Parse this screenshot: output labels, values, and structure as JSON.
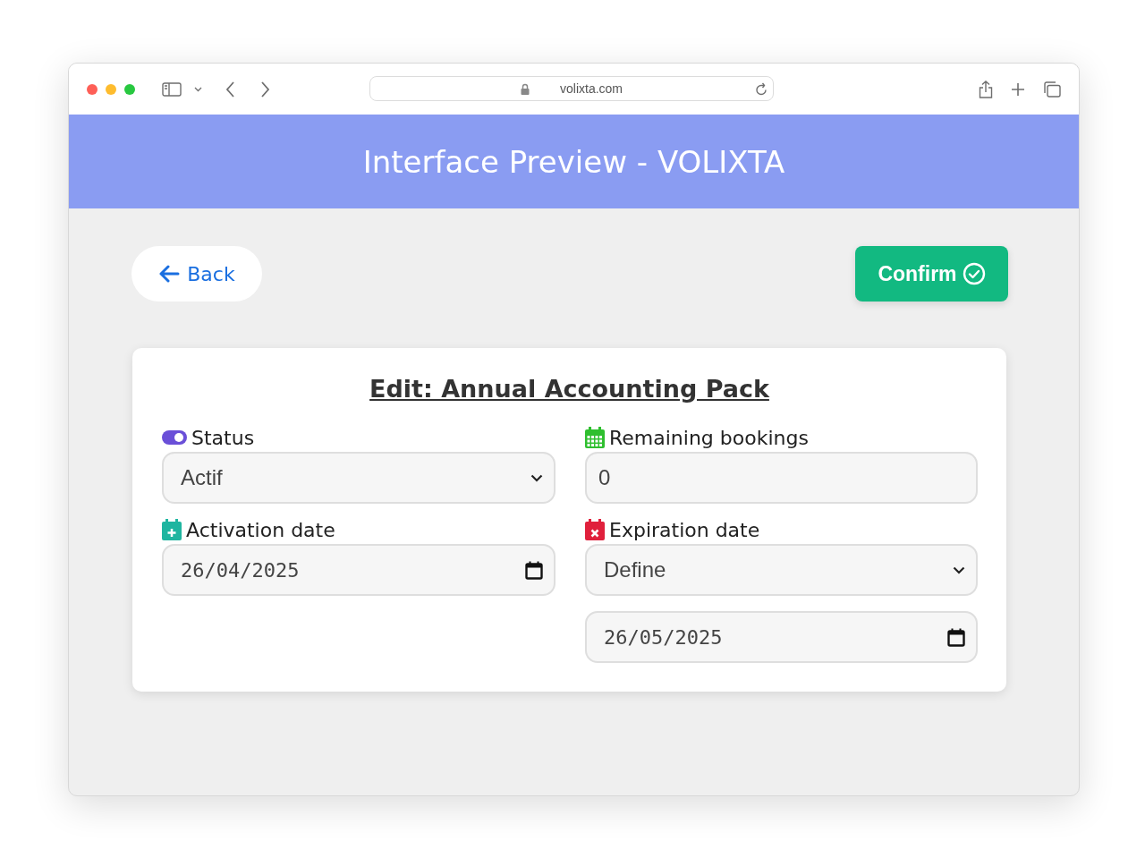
{
  "browser": {
    "url": "volixta.com"
  },
  "header": {
    "title": "Interface Preview - VOLIXTA"
  },
  "actions": [
    {
      "kind": "back",
      "label": "Back"
    },
    {
      "kind": "confirm",
      "label": "Confirm"
    }
  ],
  "form": {
    "title": "Edit: Annual Accounting Pack",
    "fields": [
      {
        "label": "Status",
        "kind": "status",
        "controls": [
          {
            "kind": "select",
            "value": "Actif"
          }
        ]
      },
      {
        "label": "Remaining bookings",
        "kind": "count",
        "controls": [
          {
            "kind": "number",
            "value": "0"
          }
        ]
      },
      {
        "label": "Activation date",
        "kind": "start",
        "controls": [
          {
            "kind": "date",
            "value": "26/04/2025"
          }
        ]
      },
      {
        "label": "Expiration date",
        "kind": "end",
        "controls": [
          {
            "kind": "select",
            "value": "Define"
          },
          {
            "kind": "date",
            "value": "26/05/2025"
          }
        ]
      }
    ]
  }
}
